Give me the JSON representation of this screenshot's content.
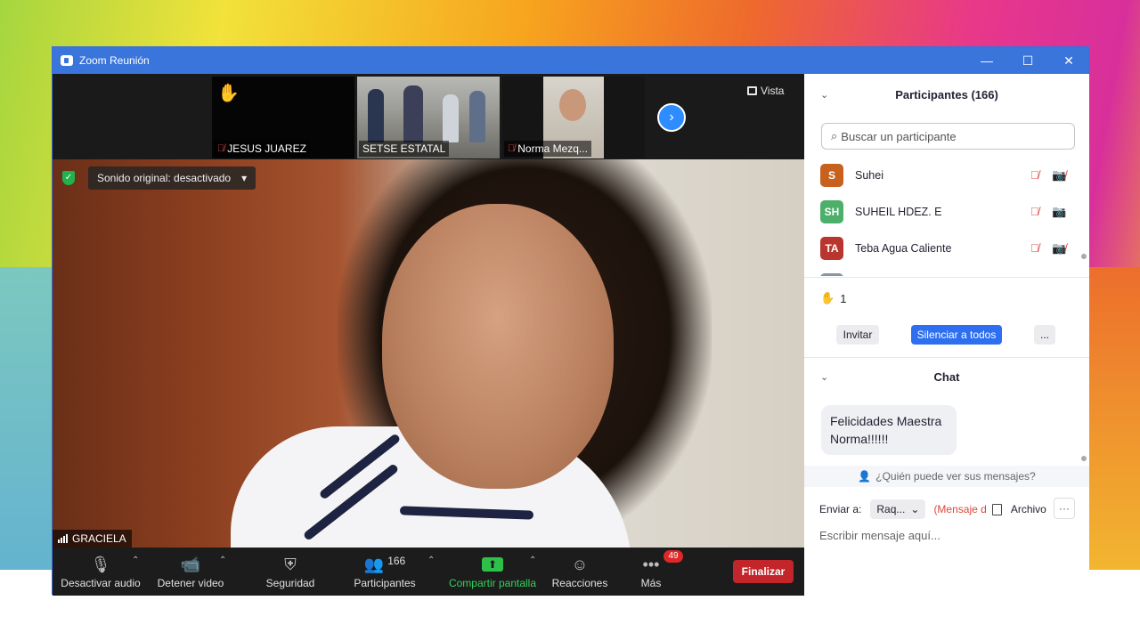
{
  "window": {
    "title": "Zoom Reunión",
    "minimize": "—",
    "maximize": "☐",
    "close": "✕"
  },
  "strip": {
    "thumbnails": [
      {
        "name": "JESUS JUAREZ",
        "hand": "✋"
      },
      {
        "name": "SETSE ESTATAL"
      },
      {
        "name": "Norma Mezq..."
      }
    ],
    "next": "›",
    "view_label": "Vista"
  },
  "video": {
    "sound_label": "Sonido original: desactivado",
    "sound_caret": "▾",
    "shield_glyph": "✓",
    "speaker_name": "GRACIELA"
  },
  "toolbar": {
    "audio_label": "Desactivar audio",
    "video_label": "Detener video",
    "security_label": "Seguridad",
    "participants_label": "Participantes",
    "participants_count": "166",
    "share_label": "Compartir pantalla",
    "reactions_label": "Reacciones",
    "more_label": "Más",
    "more_badge": "49",
    "end_label": "Finalizar",
    "caret": "⌃",
    "icons": {
      "mic": "🎙",
      "camera": "📹",
      "shield": "⛨",
      "people": "👥",
      "share": "⬆",
      "reaction": "☺",
      "more": "•••"
    }
  },
  "participants": {
    "title": "Participantes (166)",
    "collapse": "⌄",
    "search_placeholder": "Buscar un participante",
    "search_icon": "⌕",
    "list": [
      {
        "initials": "S",
        "name": "Suhei",
        "color": "#c8611e",
        "mic": "🎙̸",
        "cam": "📷̸"
      },
      {
        "initials": "SH",
        "name": "SUHEIL HDEZ. E",
        "color": "#4caf6a",
        "mic": "🎙̸",
        "cam": "📷"
      },
      {
        "initials": "TA",
        "name": "Teba Agua Caliente",
        "color": "#b8362e",
        "mic": "🎙̸",
        "cam": "📷̸"
      }
    ],
    "raised_hand": "✋",
    "raised_count": "1",
    "invite_label": "Invitar",
    "mute_all_label": "Silenciar a todos",
    "more_label": "..."
  },
  "chat": {
    "title": "Chat",
    "collapse": "⌄",
    "message": "Felicidades Maestra Norma!!!!!!",
    "who_sees": "¿Quién puede ver sus mensajes?",
    "who_icon": "👤",
    "send_to_label": "Enviar a:",
    "recipient": "Raq...",
    "recipient_caret": "⌄",
    "private_label": "(Mensaje d",
    "file_label": "Archivo",
    "more_label": "···",
    "input_placeholder": "Escribir mensaje aquí..."
  }
}
